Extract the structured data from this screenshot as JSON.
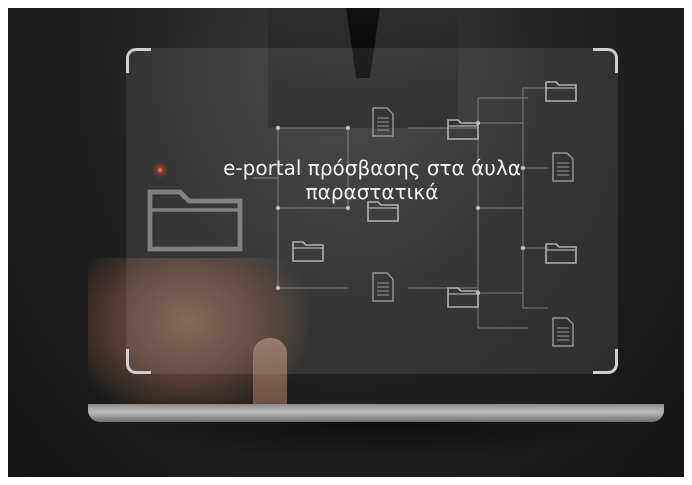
{
  "hero": {
    "title_line1": "e-portal πρόσβασης στα άυλα",
    "title_line2": "παραστατικά"
  },
  "icons": {
    "folder": "folder-icon",
    "document": "document-icon"
  },
  "colors": {
    "background": "#1a1a1a",
    "panel": "#c8c8c8",
    "text": "#f2f2f2",
    "accent": "#ff5a3c"
  }
}
